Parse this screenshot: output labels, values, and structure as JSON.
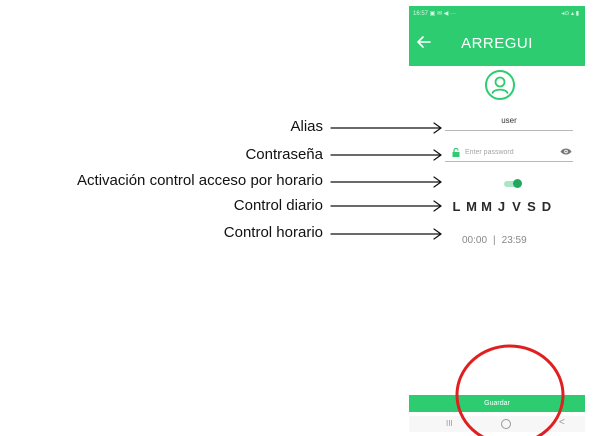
{
  "status_bar": {
    "left_text": "16:57 ▣ ✉ ◀ ···",
    "right_text": "◂⊙ ▴ ▮"
  },
  "app_bar": {
    "brand": "ARREGUI",
    "back_icon": "arrow-left-icon"
  },
  "user_icon": "user-circle-icon",
  "alias": {
    "value": "user"
  },
  "password": {
    "placeholder": "Enter password",
    "lock_icon": "unlock-icon",
    "visibility_icon": "eye-icon"
  },
  "schedule_toggle": {
    "on": true
  },
  "days": [
    "L",
    "M",
    "M",
    "J",
    "V",
    "S",
    "D"
  ],
  "hours": {
    "start": "00:00",
    "separator": "|",
    "end": "23:59"
  },
  "save_label": "Guardar",
  "nav": {
    "recents": "III",
    "back": "<"
  },
  "annotations": {
    "alias": "Alias",
    "password": "Contraseña",
    "schedule_activation": "Activación control acceso por horario",
    "daily": "Control diario",
    "hourly": "Control horario"
  },
  "colors": {
    "accent": "#2ecc71",
    "highlight_circle": "#e02020"
  }
}
